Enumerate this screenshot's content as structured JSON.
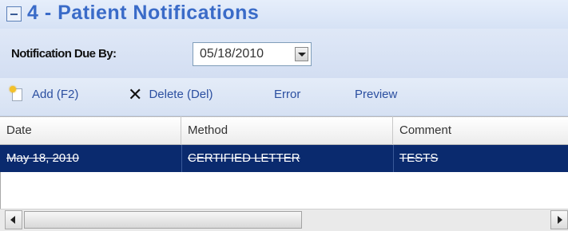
{
  "section": {
    "title": "4 - Patient Notifications"
  },
  "notification": {
    "label": "Notification Due By:",
    "date_value": "05/18/2010"
  },
  "toolbar": {
    "add_label": "Add (F2)",
    "delete_label": "Delete (Del)",
    "error_label": "Error",
    "preview_label": "Preview"
  },
  "grid": {
    "columns": [
      "Date",
      "Method",
      "Comment"
    ],
    "rows": [
      {
        "date": "May 18, 2010",
        "method": "CERTIFIED LETTER",
        "comment": "TESTS",
        "selected": true,
        "struck_through": true
      }
    ]
  },
  "colors": {
    "title": "#3a6bc8",
    "toolbar_text": "#2b4fa0",
    "selected_row": "#0a2a6e"
  },
  "icons": {
    "collapse": "collapse-minus-icon",
    "add": "new-document-icon",
    "delete": "delete-x-icon",
    "dropdown": "chevron-down-icon"
  }
}
